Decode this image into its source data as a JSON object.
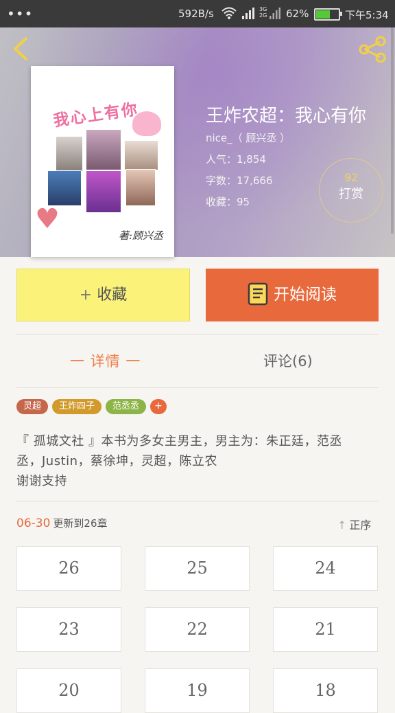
{
  "status_bar": {
    "dots": "•••",
    "speed": "592B/s",
    "signal_type": "3G",
    "signal_type2": "2G",
    "battery_pct": "62%",
    "battery_level": 0.62,
    "time": "下午5:34"
  },
  "header": {
    "cover_title": "我心上有你",
    "cover_signature": "著:顾兴丞",
    "title": "王炸农超：我心有你",
    "author": "nice_（ 顾兴丞 ）",
    "popularity": "人气：1,854",
    "words": "字数：17,666",
    "favorites": "收藏：95",
    "reward_count": "92",
    "reward_label": "打赏"
  },
  "actions": {
    "collect_plus": "+",
    "collect_label": "收藏",
    "read_label": "开始阅读"
  },
  "tabs": {
    "detail": "一 详情 一",
    "comments": "评论(6)"
  },
  "tags": [
    {
      "label": "灵超",
      "color": "#c5674b"
    },
    {
      "label": "王炸四子",
      "color": "#d19a2b"
    },
    {
      "label": "范丞丞",
      "color": "#8db446"
    }
  ],
  "tag_add": "+",
  "description": {
    "line1": "『 孤城文社 』本书为多女主男主，男主为：朱正廷，范丞",
    "line2": "丞，Justin，蔡徐坤，灵超，陈立农",
    "line3": "谢谢支持"
  },
  "update": {
    "date": "06-30",
    "text": "更新到26章"
  },
  "sort": {
    "arrow": "↑",
    "label": "正序"
  },
  "chapters": [
    "26",
    "25",
    "24",
    "23",
    "22",
    "21",
    "20",
    "19",
    "18"
  ],
  "colors": {
    "accent": "#e8693c",
    "collect_bg": "#fbf27a",
    "reward_num": "#f0d060"
  }
}
